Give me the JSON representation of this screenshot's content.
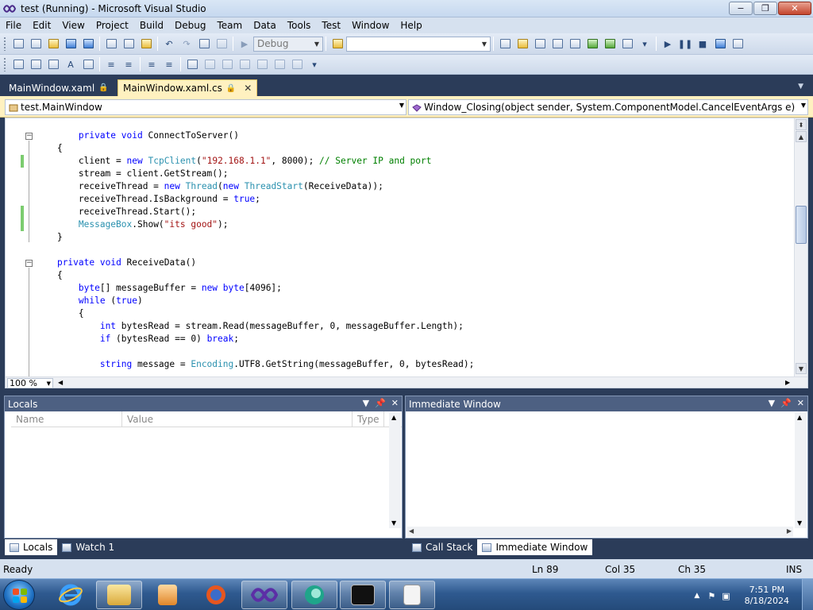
{
  "window": {
    "title": "test (Running) - Microsoft Visual Studio",
    "minimize": "−",
    "maximize": "❐",
    "close": "✕"
  },
  "menu": [
    "File",
    "Edit",
    "View",
    "Project",
    "Build",
    "Debug",
    "Team",
    "Data",
    "Tools",
    "Test",
    "Window",
    "Help"
  ],
  "toolbar": {
    "config_value": "Debug",
    "find_value": ""
  },
  "doc_tabs": {
    "tab1": "MainWindow.xaml",
    "tab2": "MainWindow.xaml.cs",
    "lock_icon": "lock-icon"
  },
  "navbar": {
    "class": "test.MainWindow",
    "member": "Window_Closing(object sender, System.ComponentModel.CancelEventArgs e)"
  },
  "editor": {
    "zoom": "100 %",
    "code_lines": [
      "        private void ConnectToServer()",
      "    {",
      "        client = new TcpClient(\"192.168.1.1\", 8000); // Server IP and port",
      "        stream = client.GetStream();",
      "        receiveThread = new Thread(new ThreadStart(ReceiveData));",
      "        receiveThread.IsBackground = true;",
      "        receiveThread.Start();",
      "        MessageBox.Show(\"its good\");",
      "    }",
      "",
      "    private void ReceiveData()",
      "    {",
      "        byte[] messageBuffer = new byte[4096];",
      "        while (true)",
      "        {",
      "            int bytesRead = stream.Read(messageBuffer, 0, messageBuffer.Length);",
      "            if (bytesRead == 0) break;",
      "",
      "            string message = Encoding.UTF8.GetString(messageBuffer, 0, bytesRead);"
    ]
  },
  "locals": {
    "title": "Locals",
    "columns": [
      "Name",
      "Value",
      "Type"
    ]
  },
  "immediate": {
    "title": "Immediate Window"
  },
  "tool_tabs": {
    "left": [
      "Locals",
      "Watch 1"
    ],
    "right": [
      "Call Stack",
      "Immediate Window"
    ]
  },
  "status": {
    "text": "Ready",
    "ln": "Ln 89",
    "col": "Col 35",
    "ch": "Ch 35",
    "mode": "INS"
  },
  "taskbar": {
    "time": "7:51 PM",
    "date": "8/18/2024"
  },
  "colors": {
    "keyword": "#0000ff",
    "type": "#2b91af",
    "string": "#a31515",
    "comment": "#008000",
    "chrome": "#2b3c59"
  }
}
